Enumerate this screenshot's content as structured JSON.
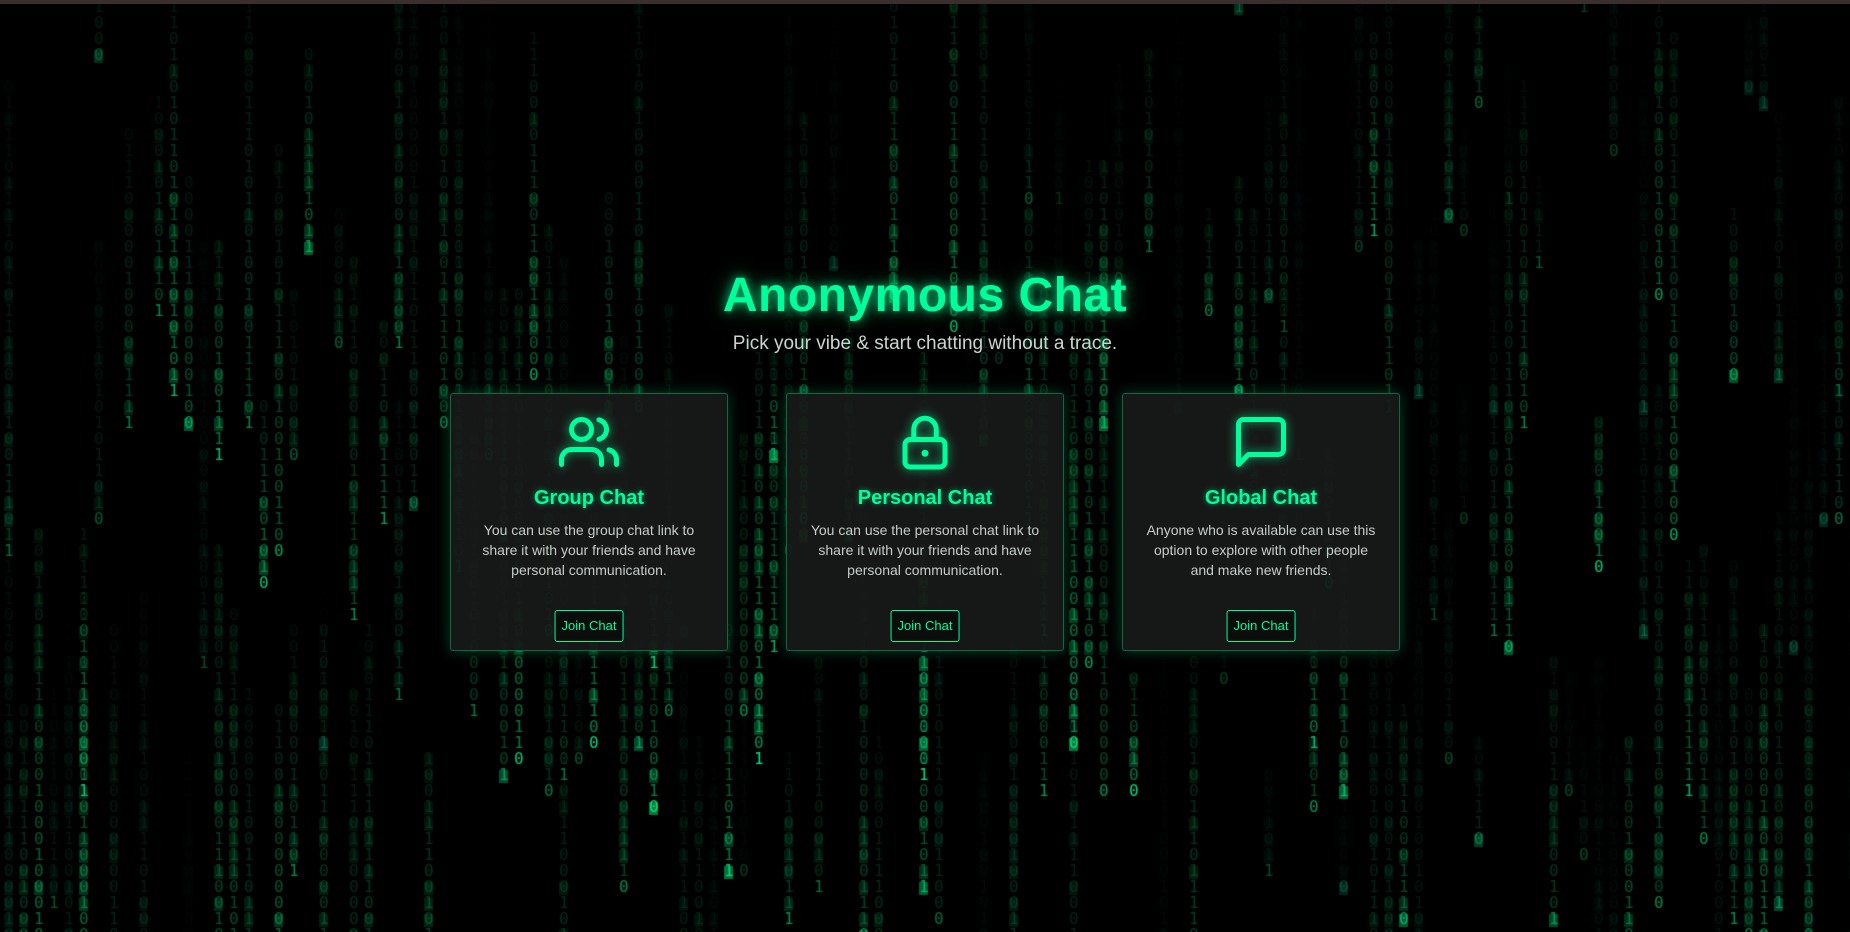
{
  "theme": {
    "accent": "#00ff9c",
    "background": "#000000",
    "card_background": "#181a19",
    "text_muted": "#c9d6cf"
  },
  "header": {
    "title": "Anonymous Chat",
    "subtitle": "Pick your vibe & start chatting without a trace."
  },
  "cards": [
    {
      "icon": "users-icon",
      "title": "Group Chat",
      "description": "You can use the group chat link to share it with your friends and have personal communication.",
      "button_label": "Join Chat"
    },
    {
      "icon": "lock-icon",
      "title": "Personal Chat",
      "description": "You can use the personal chat link to share it with your friends and have personal communication.",
      "button_label": "Join Chat"
    },
    {
      "icon": "message-square-icon",
      "title": "Global Chat",
      "description": "Anyone who is available can use this option to explore with other people and make new friends.",
      "button_label": "Join Chat"
    }
  ],
  "background": {
    "effect": "matrix-rain",
    "glyphs": [
      "0",
      "1"
    ]
  }
}
